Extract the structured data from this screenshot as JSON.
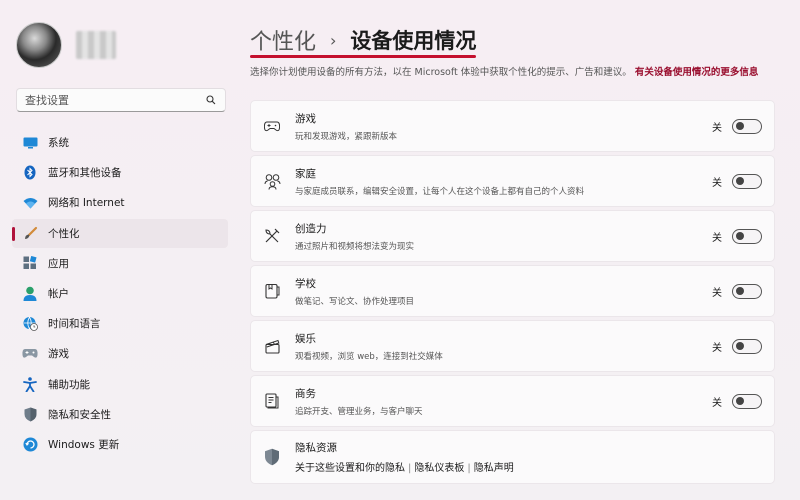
{
  "sidebar": {
    "search_placeholder": "查找设置",
    "items": [
      {
        "label": "系统",
        "icon": "display-icon"
      },
      {
        "label": "蓝牙和其他设备",
        "icon": "bluetooth-icon"
      },
      {
        "label": "网络和 Internet",
        "icon": "wifi-icon"
      },
      {
        "label": "个性化",
        "icon": "brush-icon",
        "active": true
      },
      {
        "label": "应用",
        "icon": "apps-icon"
      },
      {
        "label": "帐户",
        "icon": "person-icon"
      },
      {
        "label": "时间和语言",
        "icon": "globe-clock-icon"
      },
      {
        "label": "游戏",
        "icon": "gamepad-icon"
      },
      {
        "label": "辅助功能",
        "icon": "accessibility-icon"
      },
      {
        "label": "隐私和安全性",
        "icon": "shield-icon"
      },
      {
        "label": "Windows 更新",
        "icon": "update-icon"
      }
    ]
  },
  "header": {
    "parent": "个性化",
    "separator": "›",
    "current": "设备使用情况",
    "description": "选择你计划使用设备的所有方法，以在 Microsoft 体验中获取个性化的提示、广告和建议。",
    "description_link": "有关设备使用情况的更多信息"
  },
  "cards": [
    {
      "title": "游戏",
      "subtitle": "玩和发现游戏，紧跟新版本",
      "state": "关",
      "icon": "gamepad-icon"
    },
    {
      "title": "家庭",
      "subtitle": "与家庭成员联系，编辑安全设置，让每个人在这个设备上都有自己的个人资料",
      "state": "关",
      "icon": "family-icon"
    },
    {
      "title": "创造力",
      "subtitle": "通过照片和视频将想法变为现实",
      "state": "关",
      "icon": "creativity-icon"
    },
    {
      "title": "学校",
      "subtitle": "做笔记、写论文、协作处理项目",
      "state": "关",
      "icon": "school-icon"
    },
    {
      "title": "娱乐",
      "subtitle": "观看视频，浏览 web，连接到社交媒体",
      "state": "关",
      "icon": "clapperboard-icon"
    },
    {
      "title": "商务",
      "subtitle": "追踪开支、管理业务，与客户聊天",
      "state": "关",
      "icon": "business-icon"
    }
  ],
  "privacy": {
    "title": "隐私资源",
    "links": [
      "关于这些设置和你的隐私",
      "隐私仪表板",
      "隐私声明"
    ],
    "icon": "shield-icon"
  },
  "colors": {
    "accent": "#c4102e",
    "link": "#9a0f2f"
  }
}
